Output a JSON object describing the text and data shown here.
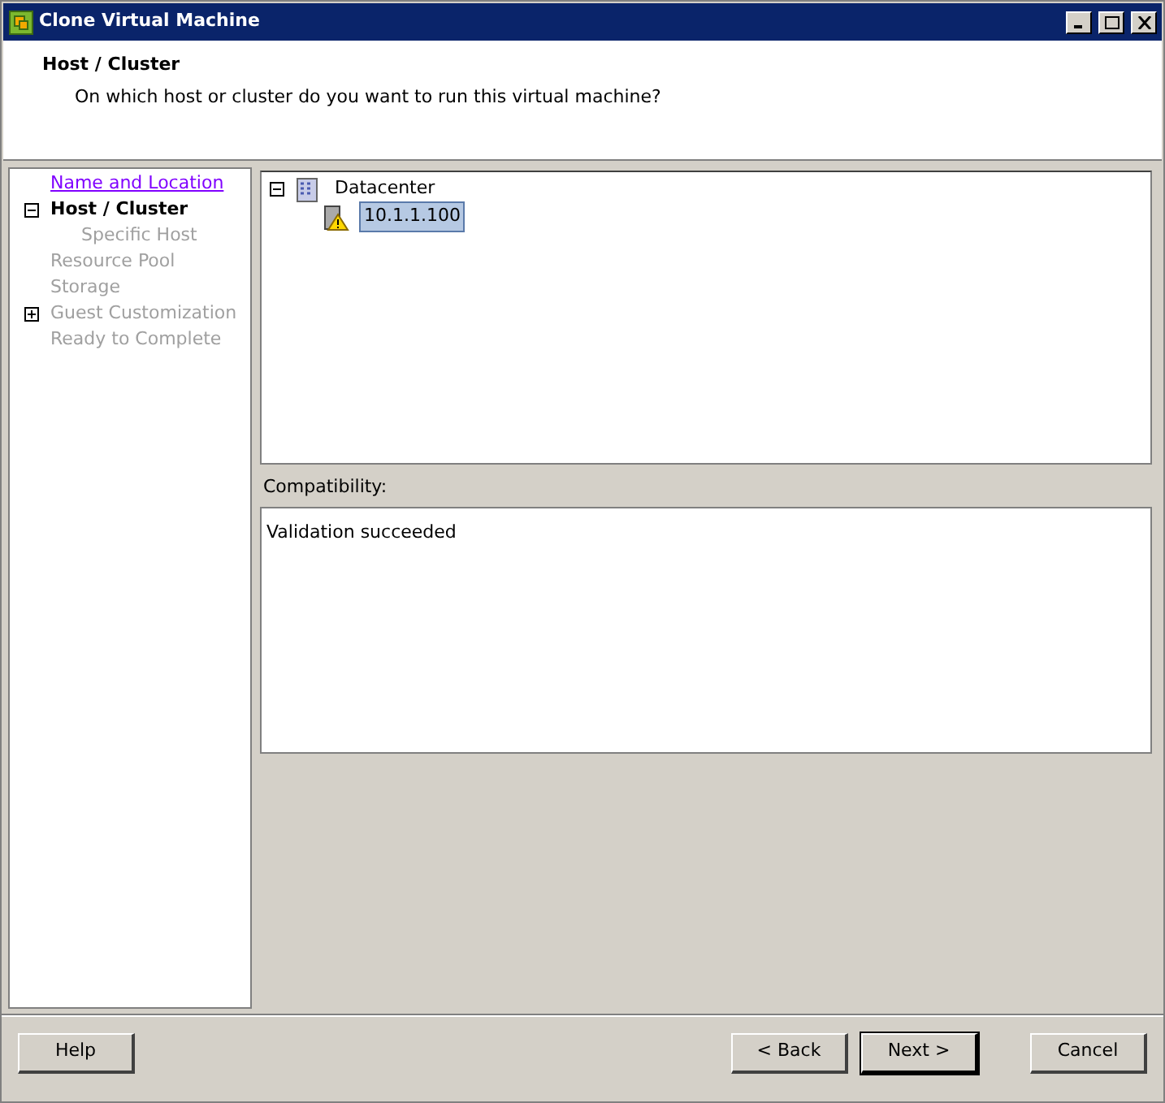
{
  "window": {
    "title": "Clone Virtual Machine"
  },
  "header": {
    "title": "Host / Cluster",
    "subtitle": "On which host or cluster do you want to run this virtual machine?"
  },
  "steps": [
    {
      "label": "Name and Location",
      "visited": true,
      "current": false
    },
    {
      "label": "Host / Cluster",
      "visited": false,
      "current": true,
      "expanded": true,
      "children": [
        {
          "label": "Specific Host",
          "visited": false,
          "current": false
        }
      ]
    },
    {
      "label": "Resource Pool",
      "visited": false,
      "current": false
    },
    {
      "label": "Storage",
      "visited": false,
      "current": false
    },
    {
      "label": "Guest Customization",
      "visited": false,
      "current": false,
      "expanded": false
    },
    {
      "label": "Ready to Complete",
      "visited": false,
      "current": false
    }
  ],
  "tree": [
    {
      "label": "Datacenter",
      "kind": "datacenter",
      "expanded": true,
      "selected": false,
      "children": [
        {
          "label": "10.1.1.100",
          "kind": "host",
          "warning": true,
          "selected": true
        }
      ]
    }
  ],
  "compatibility": {
    "label": "Compatibility:",
    "message": "Validation succeeded"
  },
  "buttons": {
    "help": "Help",
    "back": "< Back",
    "next": "Next >",
    "cancel": "Cancel"
  }
}
